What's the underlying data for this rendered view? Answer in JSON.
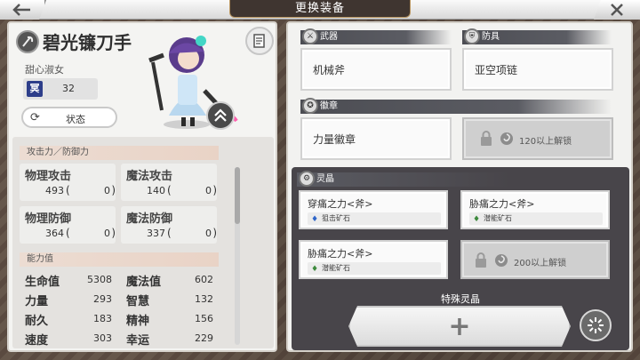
{
  "header": {
    "title": "更换装备"
  },
  "character": {
    "name": "碧光镰刀手",
    "title": "甜心淑女",
    "level_icon_text": "冥",
    "level": "32",
    "status_label": "状态"
  },
  "stats": {
    "attack_defense_header": "攻击力／防御力",
    "cards": [
      {
        "name": "物理攻击",
        "value": "493",
        "open": "(",
        "bonus": "0",
        "close": ")"
      },
      {
        "name": "魔法攻击",
        "value": "140",
        "open": "(",
        "bonus": "0",
        "close": ")"
      },
      {
        "name": "物理防御",
        "value": "364",
        "open": "(",
        "bonus": "0",
        "close": ")"
      },
      {
        "name": "魔法防御",
        "value": "337",
        "open": "(",
        "bonus": "0",
        "close": ")"
      }
    ],
    "ability_header": "能力值",
    "abilities": [
      {
        "name": "生命值",
        "value": "5308"
      },
      {
        "name": "魔法值",
        "value": "602"
      },
      {
        "name": "力量",
        "value": "293"
      },
      {
        "name": "智慧",
        "value": "132"
      },
      {
        "name": "耐久",
        "value": "183"
      },
      {
        "name": "精神",
        "value": "156"
      },
      {
        "name": "速度",
        "value": "303"
      },
      {
        "name": "幸运",
        "value": "229"
      }
    ]
  },
  "equipment": {
    "weapon_label": "武器",
    "weapon_value": "机械斧",
    "armor_label": "防具",
    "armor_value": "亚空项链",
    "badge_label": "徽章",
    "badge_value": "力量徽章",
    "badge_locked_text": "120以上解锁"
  },
  "crystals": {
    "label": "灵晶",
    "slots": [
      {
        "name": "穿痛之力<斧>",
        "stone": "狙击矿石"
      },
      {
        "name": "胁痛之力<斧>",
        "stone": "潜能矿石"
      },
      {
        "name": "胁痛之力<斧>",
        "stone": "潜能矿石"
      }
    ],
    "locked_text": "200以上解锁",
    "special_label": "特殊灵晶",
    "add_label": "+"
  }
}
